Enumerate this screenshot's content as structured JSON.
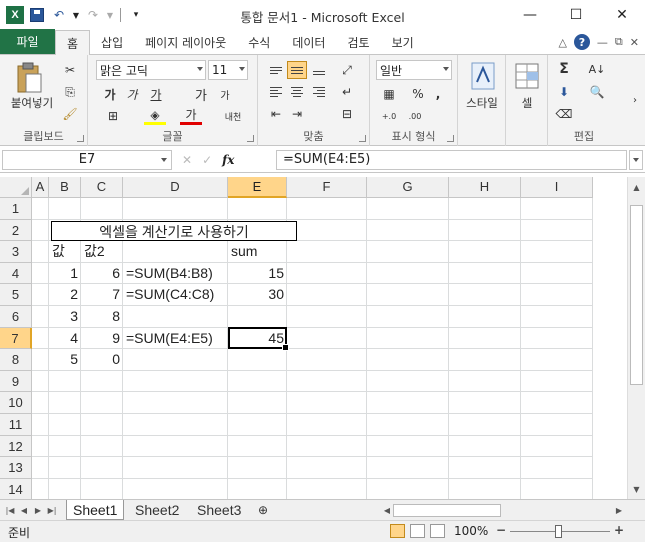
{
  "window": {
    "title": "통합 문서1 - Microsoft Excel",
    "app_logo": "X",
    "minimize": "—",
    "maximize": "☐",
    "close": "✕"
  },
  "tabs": {
    "file": "파일",
    "items": [
      "홈",
      "삽입",
      "페이지 레이아웃",
      "수식",
      "데이터",
      "검토",
      "보기"
    ],
    "active": "홈"
  },
  "ribbon": {
    "clipboard": {
      "label": "클립보드",
      "paste": "붙여넣기"
    },
    "font": {
      "label": "글꼴",
      "name": "맑은 고딕",
      "size": "11",
      "bold": "가",
      "italic": "가",
      "underline": "가",
      "grow": "가",
      "shrink": "가",
      "phonetic": "내천",
      "font_color": "가"
    },
    "alignment": {
      "label": "맞춤"
    },
    "number": {
      "label": "표시 형식",
      "format": "일반",
      "percent": "%",
      "comma": ","
    },
    "styles": {
      "label": "스타일"
    },
    "cells": {
      "label": "셀"
    },
    "editing": {
      "label": "편집",
      "sum": "Σ"
    }
  },
  "formula_bar": {
    "name_box": "E7",
    "fx": "fx",
    "formula": "=SUM(E4:E5)"
  },
  "grid": {
    "columns": [
      "A",
      "B",
      "C",
      "D",
      "E",
      "F",
      "G",
      "H",
      "I"
    ],
    "rows": [
      "1",
      "2",
      "3",
      "4",
      "5",
      "6",
      "7",
      "8",
      "9",
      "10",
      "11",
      "12",
      "13",
      "14"
    ],
    "selected_col": "E",
    "selected_row": "7",
    "title_box": "엑셀을 계산기로 사용하기",
    "cells": {
      "B3": "값",
      "C3": "값2",
      "E3": "sum",
      "B4": "1",
      "C4": "6",
      "D4": "=SUM(B4:B8)",
      "E4": "15",
      "B5": "2",
      "C5": "7",
      "D5": "=SUM(C4:C8)",
      "E5": "30",
      "B6": "3",
      "C6": "8",
      "B7": "4",
      "C7": "9",
      "D7": "=SUM(E4:E5)",
      "E7": "45",
      "B8": "5",
      "C8": "0"
    }
  },
  "sheets": {
    "items": [
      "Sheet1",
      "Sheet2",
      "Sheet3"
    ],
    "active": "Sheet1"
  },
  "status": {
    "mode": "준비",
    "zoom": "100%",
    "zoom_minus": "−",
    "zoom_plus": "+"
  },
  "colors": {
    "file_tab": "#217346",
    "header_selected": "#ffd58a",
    "grid_line": "#dadcdd"
  }
}
